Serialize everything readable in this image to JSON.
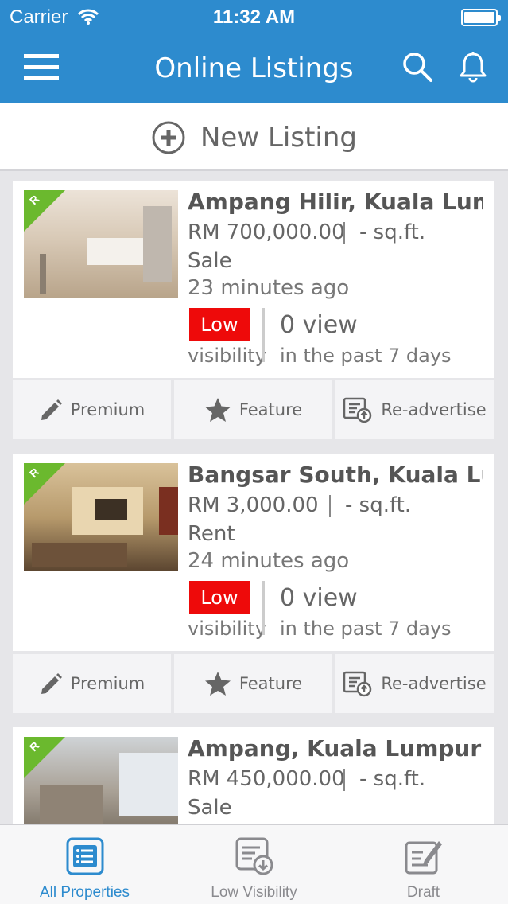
{
  "status_bar": {
    "carrier": "Carrier",
    "time": "11:32 AM"
  },
  "header": {
    "title": "Online Listings",
    "menu_icon": "hamburger-icon",
    "search_icon": "search-icon",
    "notification_icon": "bell-icon"
  },
  "new_listing": {
    "label": "New Listing",
    "icon": "plus-circle-icon"
  },
  "listings": [
    {
      "title": "Ampang Hilir, Kuala Lum...",
      "price": "RM 700,000.00",
      "area": "- sq.ft.",
      "type": "Sale",
      "posted": "23 minutes ago",
      "visibility_badge": "Low",
      "visibility_label": "visibility",
      "views": "0 view",
      "views_period": "in the past 7 days"
    },
    {
      "title": "Bangsar South, Kuala Lu...",
      "price": "RM 3,000.00",
      "area": "- sq.ft.",
      "type": "Rent",
      "posted": "24 minutes ago",
      "visibility_badge": "Low",
      "visibility_label": "visibility",
      "views": "0 view",
      "views_period": "in the past 7 days"
    },
    {
      "title": "Ampang, Kuala Lumpur",
      "price": "RM 450,000.00",
      "area": "- sq.ft.",
      "type": "Sale"
    }
  ],
  "listing_actions": {
    "premium": "Premium",
    "feature": "Feature",
    "readvertise": "Re-advertise"
  },
  "tabs": [
    {
      "label": "All Properties",
      "active": true
    },
    {
      "label": "Low Visibility",
      "active": false
    },
    {
      "label": "Draft",
      "active": false
    }
  ],
  "colors": {
    "brand_blue": "#2d8bce",
    "low_red": "#ee0a0a",
    "badge_green": "#6bb92e"
  }
}
